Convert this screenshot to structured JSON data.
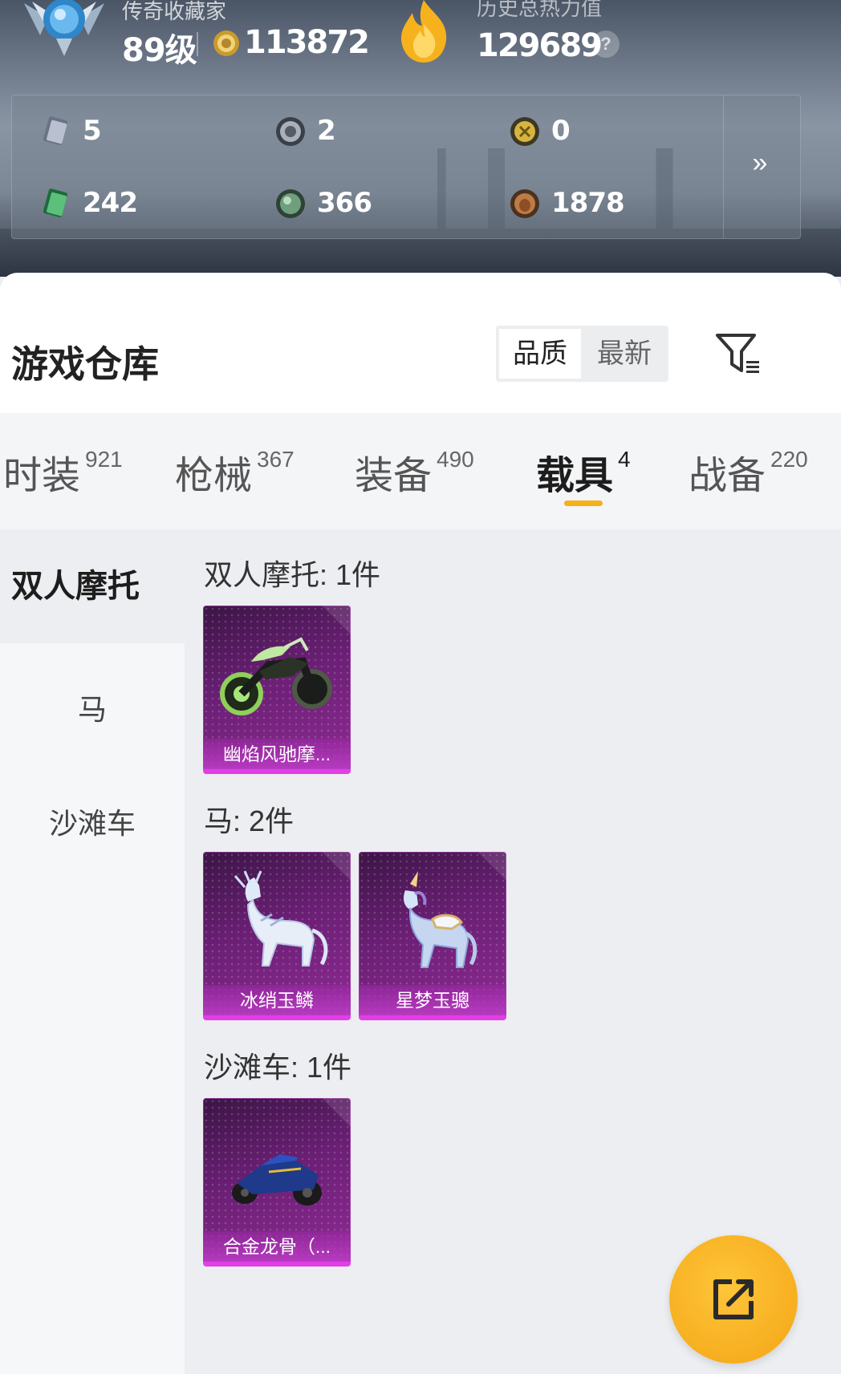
{
  "profile": {
    "title": "传奇收藏家",
    "level": "89级",
    "coins": "113872",
    "power_label": "历史总热力值",
    "power_value": "129689",
    "help_symbol": "?"
  },
  "stats": [
    {
      "icon": "silver-card-icon",
      "value": "5"
    },
    {
      "icon": "silver-coin-icon",
      "value": "2"
    },
    {
      "icon": "gold-medal-icon",
      "value": "0"
    },
    {
      "icon": "green-card-icon",
      "value": "242"
    },
    {
      "icon": "green-orb-icon",
      "value": "366"
    },
    {
      "icon": "bronze-bag-icon",
      "value": "1878"
    }
  ],
  "stats_more": "»",
  "page_title": "游戏仓库",
  "sort": {
    "quality": "品质",
    "newest": "最新"
  },
  "tabs": [
    {
      "label": "时装",
      "count": "921"
    },
    {
      "label": "枪械",
      "count": "367"
    },
    {
      "label": "装备",
      "count": "490"
    },
    {
      "label": "载具",
      "count": "4"
    },
    {
      "label": "战备",
      "count": "220"
    }
  ],
  "active_tab": "载具",
  "sidebar": [
    "双人摩托",
    "马",
    "沙滩车"
  ],
  "sections": [
    {
      "title": "双人摩托: 1件",
      "items": [
        "幽焰风驰摩..."
      ]
    },
    {
      "title": "马: 2件",
      "items": [
        "冰绡玉鳞",
        "星梦玉骢"
      ]
    },
    {
      "title": "沙滩车: 1件",
      "items": [
        "合金龙骨（..."
      ]
    }
  ],
  "colors": {
    "accent": "#f5b01a",
    "card_bg": "#6a1f74",
    "card_border": "#e23ee6"
  }
}
